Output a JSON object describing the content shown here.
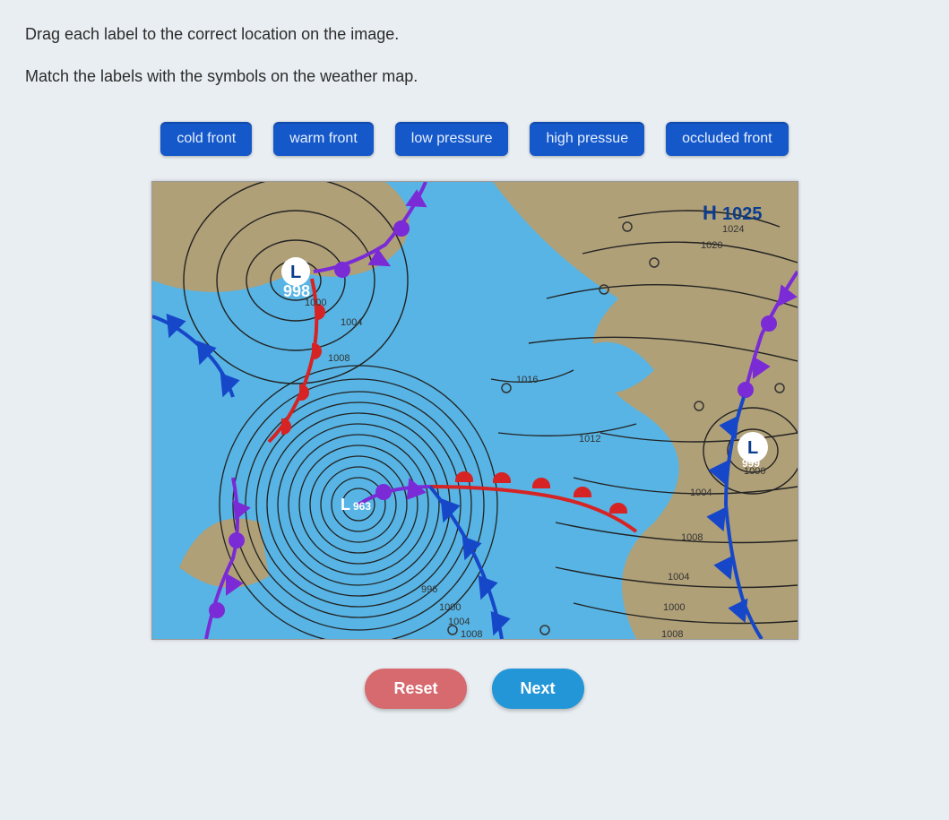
{
  "instruction_line": "Drag each label to the correct location on the image.",
  "sub_instruction": "Match the labels with the symbols on the weather map.",
  "labels": {
    "cold": "cold front",
    "warm": "warm front",
    "lowp": "low pressure",
    "highp": "high pressue",
    "occl": "occluded front"
  },
  "buttons": {
    "reset": "Reset",
    "next": "Next"
  },
  "map": {
    "H_label": "H",
    "H_value": "1025",
    "L1_label": "L",
    "L1_value": "998",
    "L2_label": "L",
    "L2_value": "963",
    "L3_label": "L",
    "L3_value": "999",
    "iso": {
      "a": "1000",
      "b": "1004",
      "c": "1008",
      "d": "1012",
      "e": "1016",
      "f": "1020",
      "g": "1024",
      "h": "1004",
      "i": "1008",
      "j": "1004",
      "k": "1000",
      "l": "1000",
      "m": "996",
      "n": "1000",
      "o": "1004",
      "p": "1008",
      "q": "1008"
    }
  }
}
